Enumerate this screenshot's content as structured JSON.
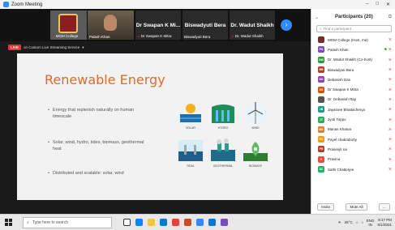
{
  "window": {
    "title": "Zoom Meeting",
    "controls": [
      "–",
      "□",
      "✕"
    ]
  },
  "gallery": {
    "tiles": [
      {
        "caption": "MGM College"
      },
      {
        "caption": "Palash Khan"
      },
      {
        "name": "Dr Swapan K Mi...",
        "caption": "Dr Swapan K Mitra"
      },
      {
        "name": "Biswadyuti Bera",
        "caption": "Biswadyuti Bera"
      },
      {
        "name": "Dr. Wadut Shaikh",
        "caption": "Dr. Wadut Shaikh"
      }
    ],
    "next_icon": "›"
  },
  "livebar": {
    "badge": "LIVE",
    "text": "on Custom Live Streaming Service",
    "chevron": "▾"
  },
  "slide": {
    "title": "Renewable Energy",
    "bullets": [
      "Energy that replenish naturally on human timescale",
      "Solar, wind, hydro, tides, biomass, geothermal heat",
      "Distributed and scalable: solar, wind"
    ],
    "icon_labels": [
      "SOLAR",
      "HYDRO",
      "WIND",
      "TIDAL",
      "GEOTHERMAL",
      "BIOMASS"
    ]
  },
  "participants": {
    "header": "Participants (20)",
    "search_placeholder": "Find a participant",
    "list": [
      {
        "initials": "",
        "name": "MGM College (Host, me)",
        "color": "#7a2a2a"
      },
      {
        "initials": "PK",
        "name": "Palash Khan",
        "color": "#7a4fb3",
        "cam": true
      },
      {
        "initials": "DW",
        "name": "Dr. Wadut Shaikh (Co-host)",
        "color": "#2a9d3a"
      },
      {
        "initials": "BB",
        "name": "Biswadyuti Bera",
        "color": "#c0392b"
      },
      {
        "initials": "DD",
        "name": "Debasish Das",
        "color": "#8e44ad"
      },
      {
        "initials": "DS",
        "name": "Dr Swapan K Mitra",
        "color": "#d35400"
      },
      {
        "initials": "",
        "name": "Dr. Debasish Ray",
        "color": "#555555"
      },
      {
        "initials": "JB",
        "name": "Jayasree Bhattacherya",
        "color": "#16a085"
      },
      {
        "initials": "JT",
        "name": "Jyoti Toppo",
        "color": "#27ae60"
      },
      {
        "initials": "MK",
        "name": "Manas Khatua",
        "color": "#e67e22"
      },
      {
        "initials": "PC",
        "name": "Payel chakraborty",
        "color": "#f39c12"
      },
      {
        "initials": "PR",
        "name": "Prasenjit rai",
        "color": "#c0392b"
      },
      {
        "initials": "P",
        "name": "Pravina",
        "color": "#e74c3c"
      },
      {
        "initials": "SC",
        "name": "Sathi Chatterjee",
        "color": "#27ae60"
      }
    ],
    "footer": [
      "Invite",
      "Mute All",
      "..."
    ]
  },
  "taskbar": {
    "search_text": "Type here to search",
    "temperature": "26°C",
    "lang": "ENG",
    "region": "IN",
    "time": "8:17 PM",
    "date": "6/1/2021"
  }
}
